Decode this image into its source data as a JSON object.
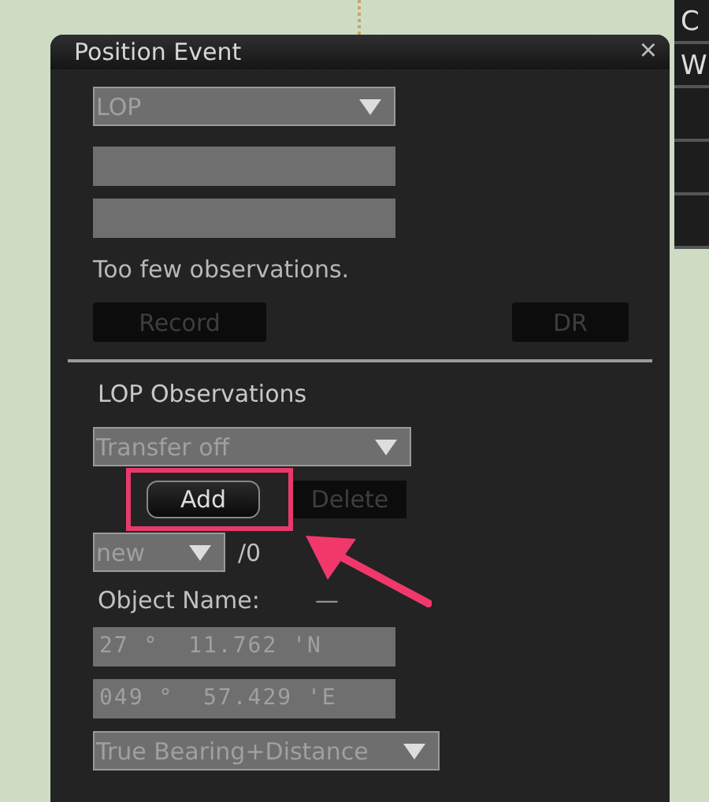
{
  "dialog": {
    "title": "Position Event",
    "close": "×",
    "mode_select": {
      "value": "LOP"
    },
    "message": "Too few observations.",
    "buttons": [
      {
        "label": "Record",
        "disabled": true
      },
      {
        "label": "DR",
        "disabled": true
      }
    ],
    "section": {
      "title": "LOP Observations",
      "transfer_select": {
        "value": "Transfer off"
      },
      "actions": [
        {
          "label": "Add",
          "disabled": false,
          "highlighted": true
        },
        {
          "label": "Delete",
          "disabled": true,
          "highlighted": false
        }
      ],
      "index_select": {
        "value": "new"
      },
      "count": "/0",
      "object_label": "Object Name:",
      "object_value": "—",
      "latitude": "27 °  11.762 'N",
      "longitude": "049 °  57.429 'E",
      "method_select": {
        "value": "True Bearing+Distance"
      }
    }
  },
  "side_panel": {
    "items": [
      "C",
      "W"
    ]
  }
}
